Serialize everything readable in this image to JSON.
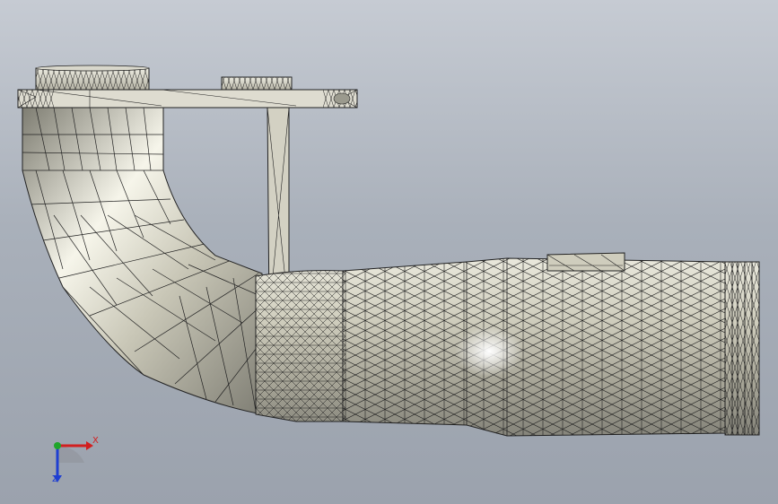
{
  "viewport": {
    "background_top": "#c6cbd3",
    "background_bottom": "#9ba2ad"
  },
  "model": {
    "render_style": "shaded-with-mesh-edges",
    "surface_color": "#d6d4c4",
    "highlight_color": "#ffffff",
    "edge_color": "#1a1a1a",
    "parts": [
      "elbow-pipe",
      "top-flange",
      "mounting-bracket",
      "bracket-strut",
      "straight-pipe",
      "tapered-pipe",
      "end-ring-grooves",
      "top-boss"
    ]
  },
  "triad": {
    "x_label": "X",
    "z_label": "Z",
    "x_color": "#d21f1f",
    "y_color": "#1fa52a",
    "z_color": "#1f3fd2"
  }
}
